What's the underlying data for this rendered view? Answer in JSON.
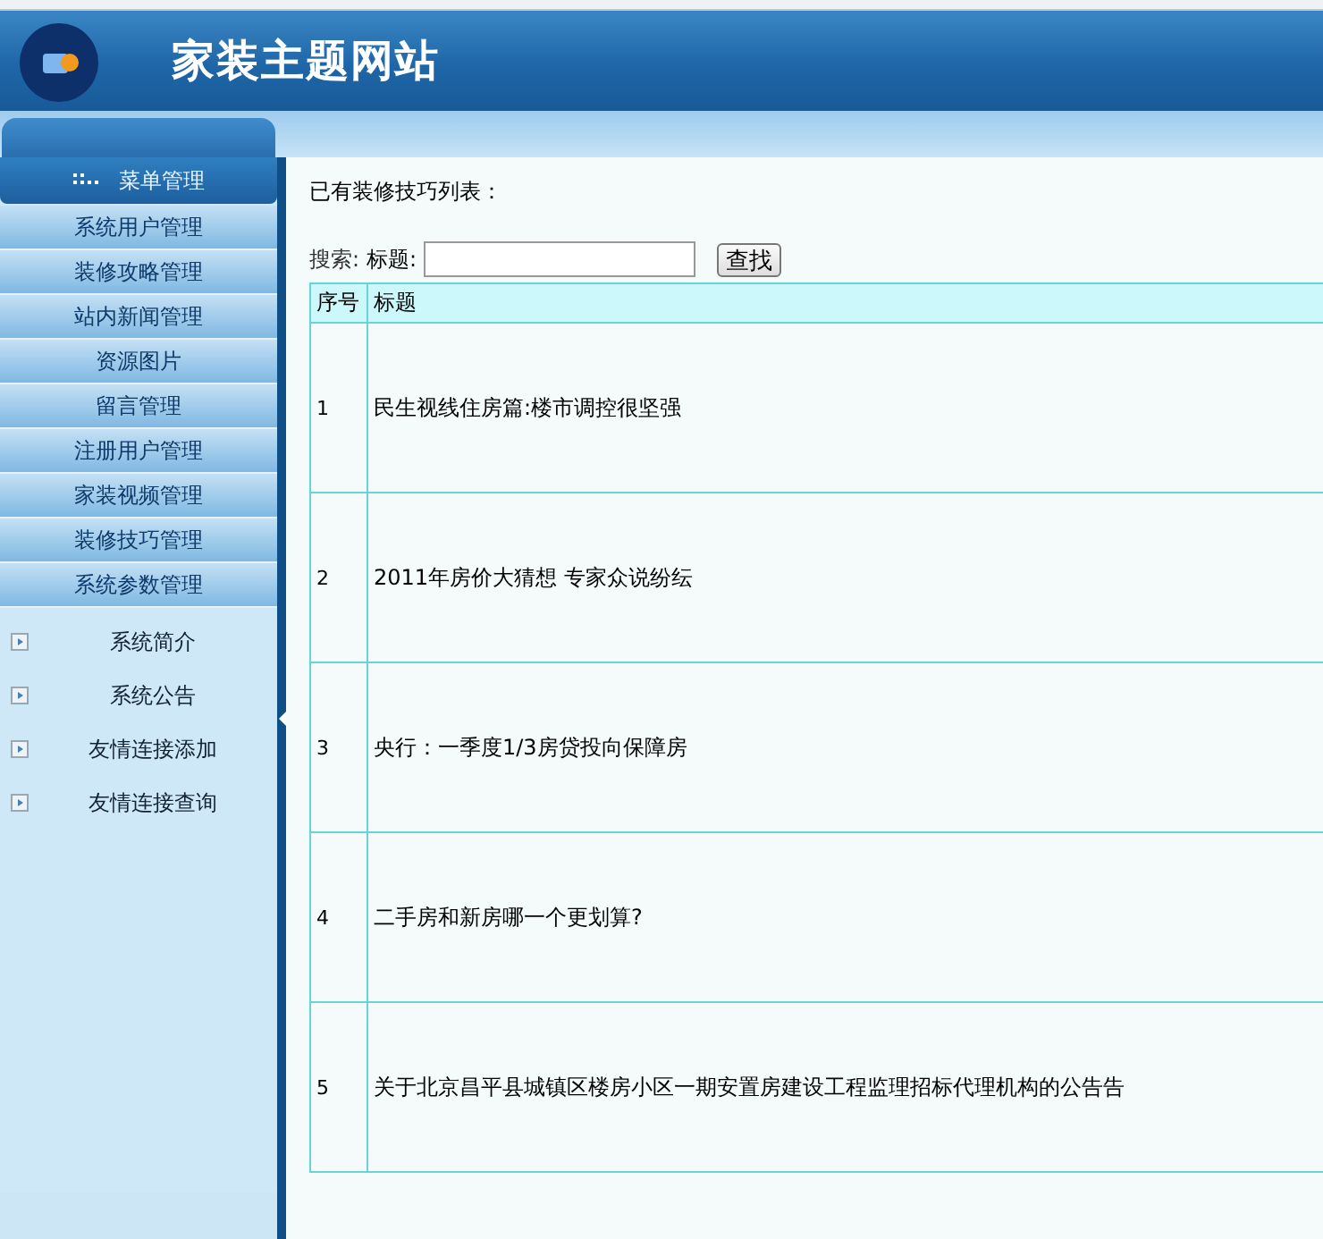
{
  "header": {
    "title": "家装主题网站"
  },
  "sidebar": {
    "heading": "菜单管理",
    "items": [
      "系统用户管理",
      "装修攻略管理",
      "站内新闻管理",
      "资源图片",
      "留言管理",
      "注册用户管理",
      "家装视频管理",
      "装修技巧管理",
      "系统参数管理"
    ],
    "tree_items": [
      "系统简介",
      "系统公告",
      "友情连接添加",
      "友情连接查询"
    ]
  },
  "main": {
    "caption": "已有装修技巧列表：",
    "search": {
      "prefix": "搜索:",
      "label": "标题:",
      "button": "查找"
    },
    "table": {
      "columns": [
        "序号",
        "标题"
      ],
      "rows": [
        {
          "no": "1",
          "title": "民生视线住房篇:楼市调控很坚强"
        },
        {
          "no": "2",
          "title": "2011年房价大猜想 专家众说纷纭"
        },
        {
          "no": "3",
          "title": "央行：一季度1/3房贷投向保障房"
        },
        {
          "no": "4",
          "title": "二手房和新房哪一个更划算?"
        },
        {
          "no": "5",
          "title": "关于北京昌平县城镇区楼房小区一期安置房建设工程监理招标代理机构的公告告"
        }
      ]
    }
  }
}
